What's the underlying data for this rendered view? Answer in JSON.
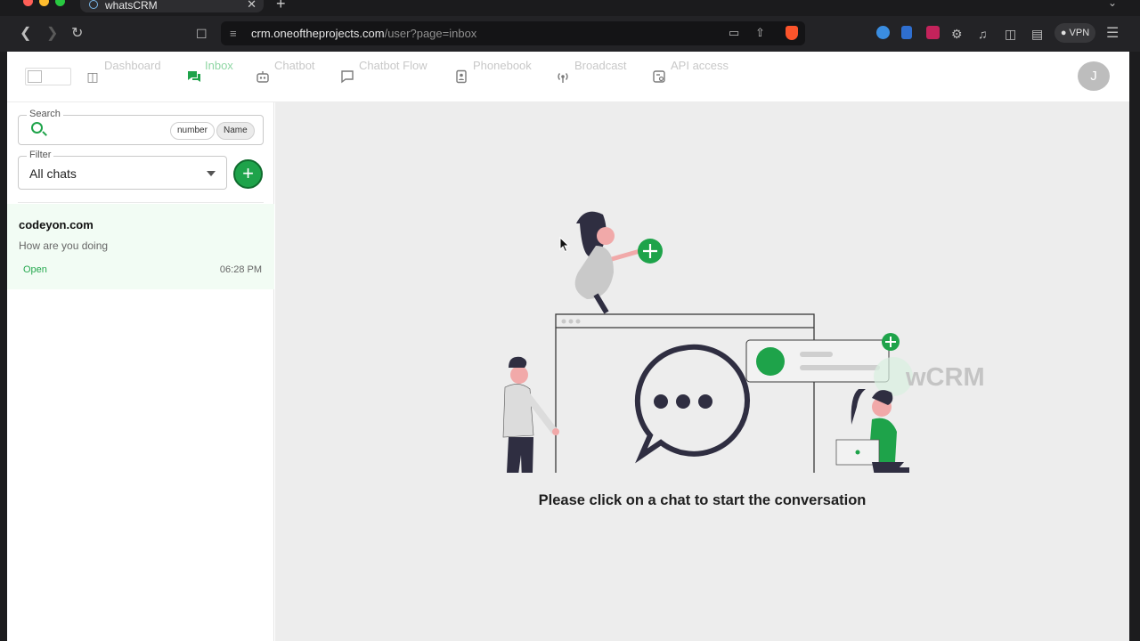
{
  "browser": {
    "tab_title": "whatsCRM",
    "url_host": "crm.oneoftheprojects.com",
    "url_path": "/user?page=inbox",
    "vpn_label": "VPN"
  },
  "nav": {
    "items": [
      {
        "label": "Dashboard",
        "icon": "dashboard-icon"
      },
      {
        "label": "Inbox",
        "icon": "chat-icon",
        "active": true
      },
      {
        "label": "Chatbot",
        "icon": "robot-icon"
      },
      {
        "label": "Chatbot Flow",
        "icon": "flow-icon"
      },
      {
        "label": "Phonebook",
        "icon": "phonebook-icon"
      },
      {
        "label": "Broadcast",
        "icon": "broadcast-icon"
      },
      {
        "label": "API access",
        "icon": "api-icon"
      }
    ],
    "avatar_initial": "J"
  },
  "sidebar": {
    "search_label": "Search",
    "search_chips": [
      "number",
      "Name"
    ],
    "selected_chip": "Name",
    "filter_label": "Filter",
    "filter_value": "All chats",
    "add_label": "+",
    "chats": [
      {
        "name": "codeyon.com",
        "last_message": "How are you doing",
        "status": "Open",
        "time": "06:28 PM"
      }
    ]
  },
  "main": {
    "placeholder_message": "Please click on a chat to start the conversation",
    "watermark": "wCRM"
  },
  "colors": {
    "accent": "#1ea34a",
    "active_chat_bg": "#f2fcf4",
    "main_bg": "#ededed"
  }
}
